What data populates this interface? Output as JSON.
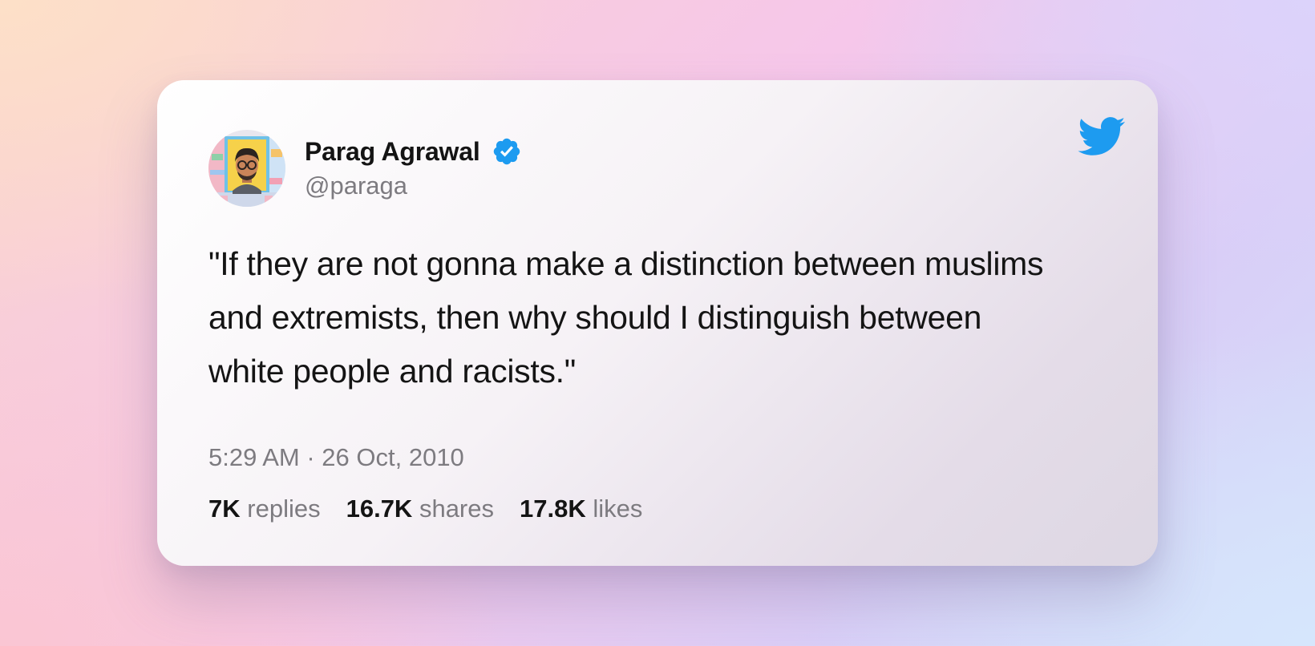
{
  "tweet": {
    "author_name": "Parag Agrawal",
    "author_handle": "@paraga",
    "verified": true,
    "text": "\"If they are not gonna make a distinction between muslims and extremists, then why should I distinguish between white people and racists.\"",
    "timestamp": "5:29 AM · 26 Oct, 2010",
    "stats": [
      {
        "value": "7K",
        "label": "replies"
      },
      {
        "value": "16.7K",
        "label": "shares"
      },
      {
        "value": "17.8K",
        "label": "likes"
      }
    ]
  },
  "icons": {
    "logo": "twitter-bird-icon",
    "badge": "verified-badge-icon",
    "avatar": "avatar-image"
  },
  "colors": {
    "twitter_blue": "#1d9bf0",
    "text_primary": "#141414",
    "text_secondary": "#7d7b80"
  }
}
